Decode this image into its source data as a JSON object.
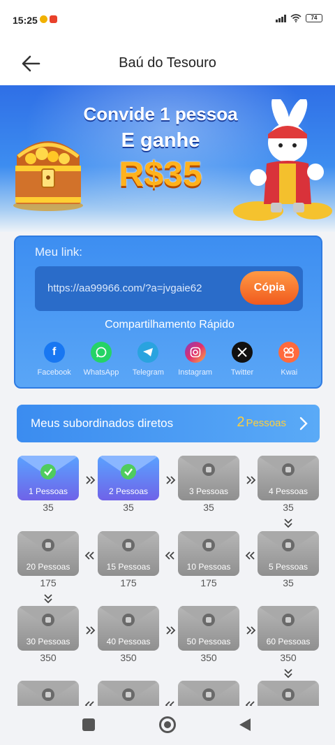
{
  "status_bar": {
    "time": "15:25",
    "battery": "74"
  },
  "header": {
    "title": "Baú do Tesouro"
  },
  "banner": {
    "line1": "Convide 1 pessoa",
    "line2": "E ganhe",
    "amount": "R$35"
  },
  "invite": {
    "link_label": "Meu link:",
    "link_url": "https://aa99966.com/?a=jvgaie62",
    "copy_label": "Cópia",
    "share_title": "Compartilhamento Rápido",
    "share": [
      {
        "name": "Facebook",
        "icon": "facebook-icon",
        "color": "#1877f2"
      },
      {
        "name": "WhatsApp",
        "icon": "whatsapp-icon",
        "color": "#25d366"
      },
      {
        "name": "Telegram",
        "icon": "telegram-icon",
        "color": "#2aa3df"
      },
      {
        "name": "Instagram",
        "icon": "instagram-icon",
        "color": "#e1306c"
      },
      {
        "name": "Twitter",
        "icon": "x-icon",
        "color": "#111111"
      },
      {
        "name": "Kwai",
        "icon": "kwai-icon",
        "color": "#ff6a3d"
      }
    ]
  },
  "subordinates": {
    "label": "Meus subordinados diretos",
    "count": "2",
    "unit": "Pessoas"
  },
  "rewards": [
    {
      "label": "1 Pessoas",
      "reward": "35",
      "done": true
    },
    {
      "label": "2 Pessoas",
      "reward": "35",
      "done": true
    },
    {
      "label": "3 Pessoas",
      "reward": "35",
      "done": false
    },
    {
      "label": "4 Pessoas",
      "reward": "35",
      "done": false
    },
    {
      "label": "5 Pessoas",
      "reward": "35",
      "done": false
    },
    {
      "label": "10 Pessoas",
      "reward": "175",
      "done": false
    },
    {
      "label": "15 Pessoas",
      "reward": "175",
      "done": false
    },
    {
      "label": "20 Pessoas",
      "reward": "175",
      "done": false
    },
    {
      "label": "30 Pessoas",
      "reward": "350",
      "done": false
    },
    {
      "label": "40 Pessoas",
      "reward": "350",
      "done": false
    },
    {
      "label": "50 Pessoas",
      "reward": "350",
      "done": false
    },
    {
      "label": "60 Pessoas",
      "reward": "350",
      "done": false
    },
    {
      "label": "",
      "reward": "",
      "done": false
    },
    {
      "label": "",
      "reward": "",
      "done": false
    },
    {
      "label": "",
      "reward": "",
      "done": false
    },
    {
      "label": "",
      "reward": "",
      "done": false
    }
  ],
  "colors": {
    "accent_blue": "#3d8ef1",
    "copy_orange": "#f05a1e",
    "count_yellow": "#ffcf3b",
    "done_check": "#4fcc5e"
  }
}
